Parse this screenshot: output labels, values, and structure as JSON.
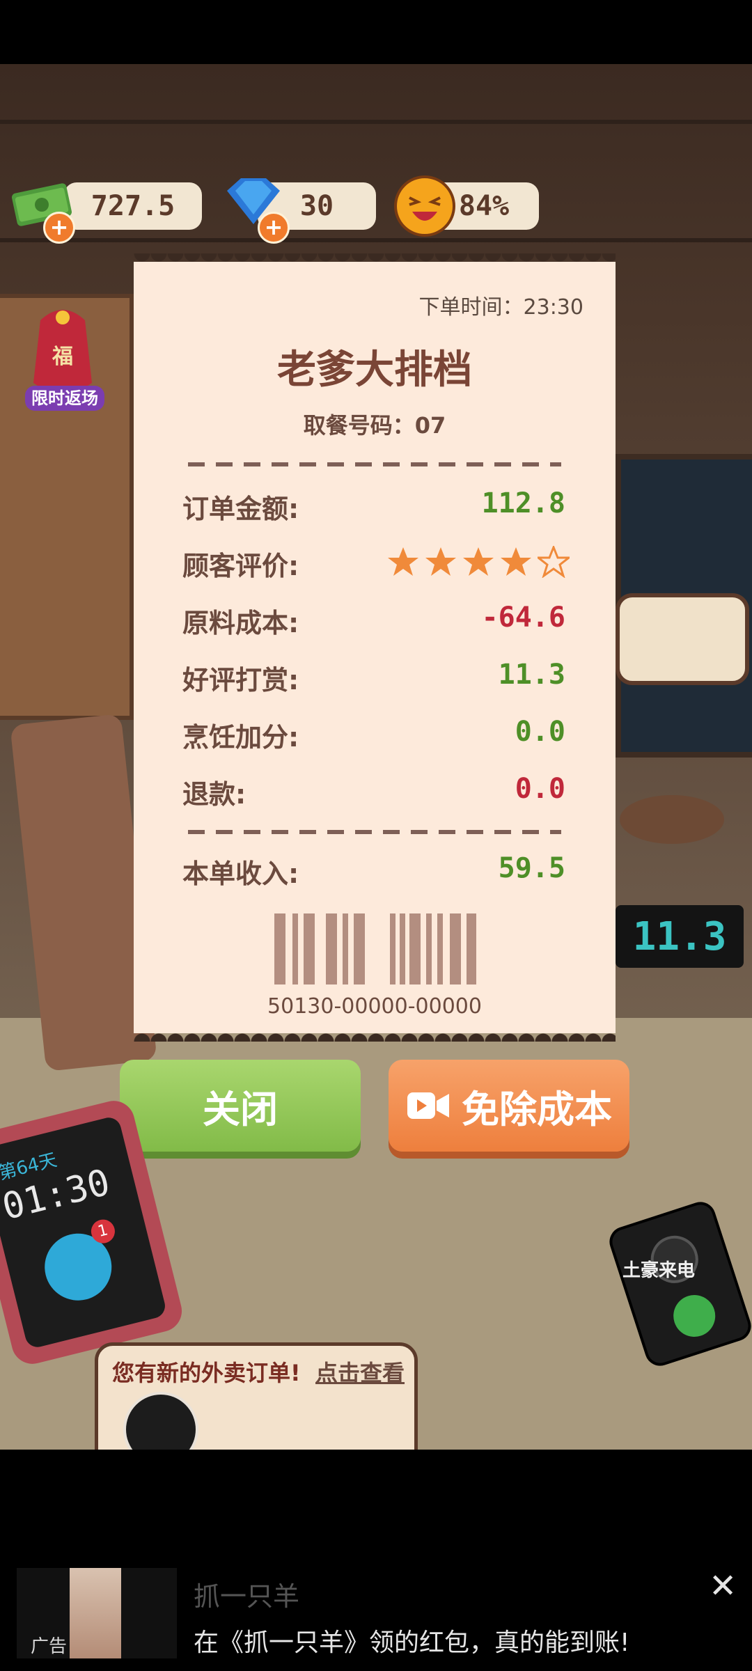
{
  "resources": {
    "cash": "727.5",
    "gems": "30",
    "satisfaction": "84%"
  },
  "event_badge": "限时返场",
  "event_badge_char": "福",
  "receipt": {
    "order_time": "下单时间：23:30",
    "shop_name": "老爹大排档",
    "pickup_number": "取餐号码：07",
    "rows": [
      {
        "label": "订单金额:",
        "value": "112.8",
        "tone": "green"
      },
      {
        "label": "顾客评价:",
        "stars_filled": 4,
        "stars_total": 5
      },
      {
        "label": "原料成本:",
        "value": "-64.6",
        "tone": "red"
      },
      {
        "label": "好评打赏:",
        "value": "11.3",
        "tone": "green"
      },
      {
        "label": "烹饪加分:",
        "value": "0.0",
        "tone": "green"
      },
      {
        "label": "退款:",
        "value": "0.0",
        "tone": "red"
      }
    ],
    "total_label": "本单收入:",
    "total_value": "59.5",
    "barcode_number": "50130-00000-00000"
  },
  "buttons": {
    "close": "关闭",
    "remove_cost": "免除成本"
  },
  "scoreboard_value": "11.3",
  "tablet": {
    "day": "第64天",
    "time": "01:30",
    "badge": "1"
  },
  "notification": {
    "text": "您有新的外卖订单!",
    "link": "点击查看"
  },
  "phone_label": "土豪来电",
  "ad": {
    "tag": "广告",
    "title": "抓一只羊",
    "desc": "在《抓一只羊》领的红包，真的能到账!"
  },
  "colors": {
    "accent_green": "#4e8f27",
    "accent_red": "#c0283a",
    "receipt_bg": "#fdeadb",
    "close_button": "#82bb48",
    "free_button": "#ee7f3d",
    "star": "#f08a3a"
  }
}
